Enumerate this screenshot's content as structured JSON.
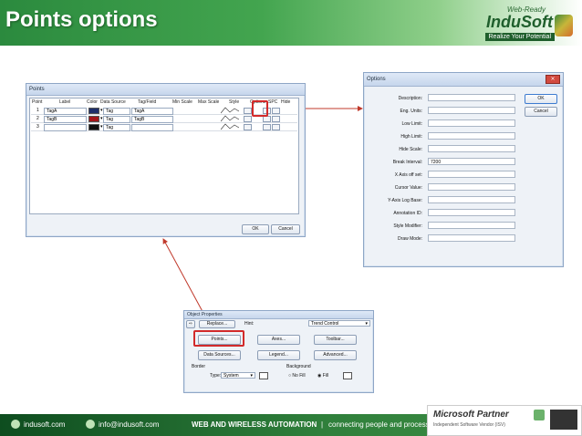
{
  "slide": {
    "title": "Points options",
    "logo": {
      "tagline": "Web-Ready",
      "brand": "InduSoft",
      "slogan": "Realize Your Potential"
    }
  },
  "points_window": {
    "title": "Points",
    "columns": [
      "Point",
      "Label",
      "Color",
      "Data Source",
      "Tag/Field",
      "Min Scale",
      "Max Scale",
      "Style",
      "Options",
      "SPC",
      "Hide"
    ],
    "rows": [
      {
        "point": "1",
        "label": "TagA",
        "source": "Tag",
        "field": "TagA",
        "color": "#1f2f6b"
      },
      {
        "point": "2",
        "label": "TagB",
        "source": "Tag",
        "field": "TagB",
        "color": "#a4161a"
      },
      {
        "point": "3",
        "label": "",
        "source": "Tag",
        "field": "",
        "color": "#111111"
      }
    ],
    "ok_label": "OK",
    "cancel_label": "Cancel"
  },
  "options_window": {
    "title": "Options",
    "fields": [
      {
        "label": "Description:",
        "value": ""
      },
      {
        "label": "Eng. Units:",
        "value": ""
      },
      {
        "label": "Low Limit:",
        "value": ""
      },
      {
        "label": "High Limit:",
        "value": ""
      },
      {
        "label": "Hide Scale:",
        "value": ""
      },
      {
        "label": "Break Interval:",
        "value": "7200"
      },
      {
        "label": "X Axis off set:",
        "value": ""
      },
      {
        "label": "Cursor Value:",
        "value": ""
      },
      {
        "label": "Y-Axis Log Base:",
        "value": ""
      },
      {
        "label": "Annotation ID:",
        "value": ""
      },
      {
        "label": "Style Modifier:",
        "value": ""
      },
      {
        "label": "Draw Mode:",
        "value": ""
      }
    ],
    "ok_label": "OK",
    "cancel_label": "Cancel"
  },
  "object_properties": {
    "title": "Object Properties",
    "replace_label": "Replace...",
    "hint_label": "Hint:",
    "type_value": "Trend Control",
    "points_label": "Points...",
    "axes_label": "Axes...",
    "toolbar_label": "Toolbar...",
    "data_sources_label": "Data Sources...",
    "legend_label": "Legend...",
    "advanced_label": "Advanced...",
    "border_label": "Border",
    "border_type_label": "Type:",
    "border_type_value": "System",
    "background_label": "Background",
    "no_fill_label": "No Fill",
    "fill_label": "Fill"
  },
  "footer": {
    "site": "indusoft.com",
    "email": "info@indusoft.com",
    "tagline": "WEB AND WIRELESS AUTOMATION",
    "tagline2": "connecting people and process"
  },
  "partner": {
    "name": "Microsoft Partner",
    "sub": "Independent Software Vendor (ISV)"
  },
  "colors": {
    "header_green": "#2b8a3e",
    "highlight_red": "#d22a2a"
  }
}
